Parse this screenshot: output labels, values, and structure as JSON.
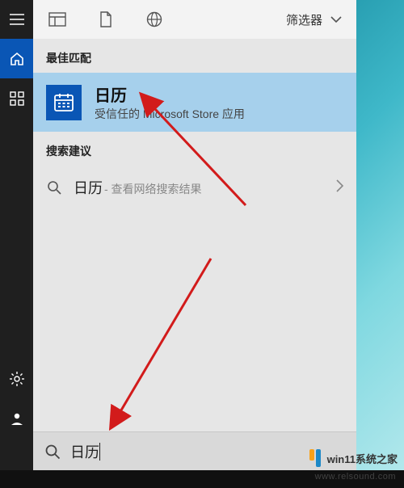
{
  "colors": {
    "accent": "#0a56b5",
    "best_match_bg": "#a6d0ec"
  },
  "leftbar": {
    "active_index": 0
  },
  "top": {
    "filter_label": "筛选器"
  },
  "sections": {
    "best_match_label": "最佳匹配",
    "suggestions_label": "搜索建议"
  },
  "best_match": {
    "title": "日历",
    "subtitle": "受信任的 Microsoft Store 应用",
    "icon": "calendar-icon"
  },
  "suggestions": [
    {
      "query": "日历",
      "hint": " - 查看网络搜索结果"
    }
  ],
  "search": {
    "value": "日历",
    "placeholder": ""
  },
  "watermark": {
    "site": "win11系统之家",
    "url": "www.relsound.com"
  }
}
